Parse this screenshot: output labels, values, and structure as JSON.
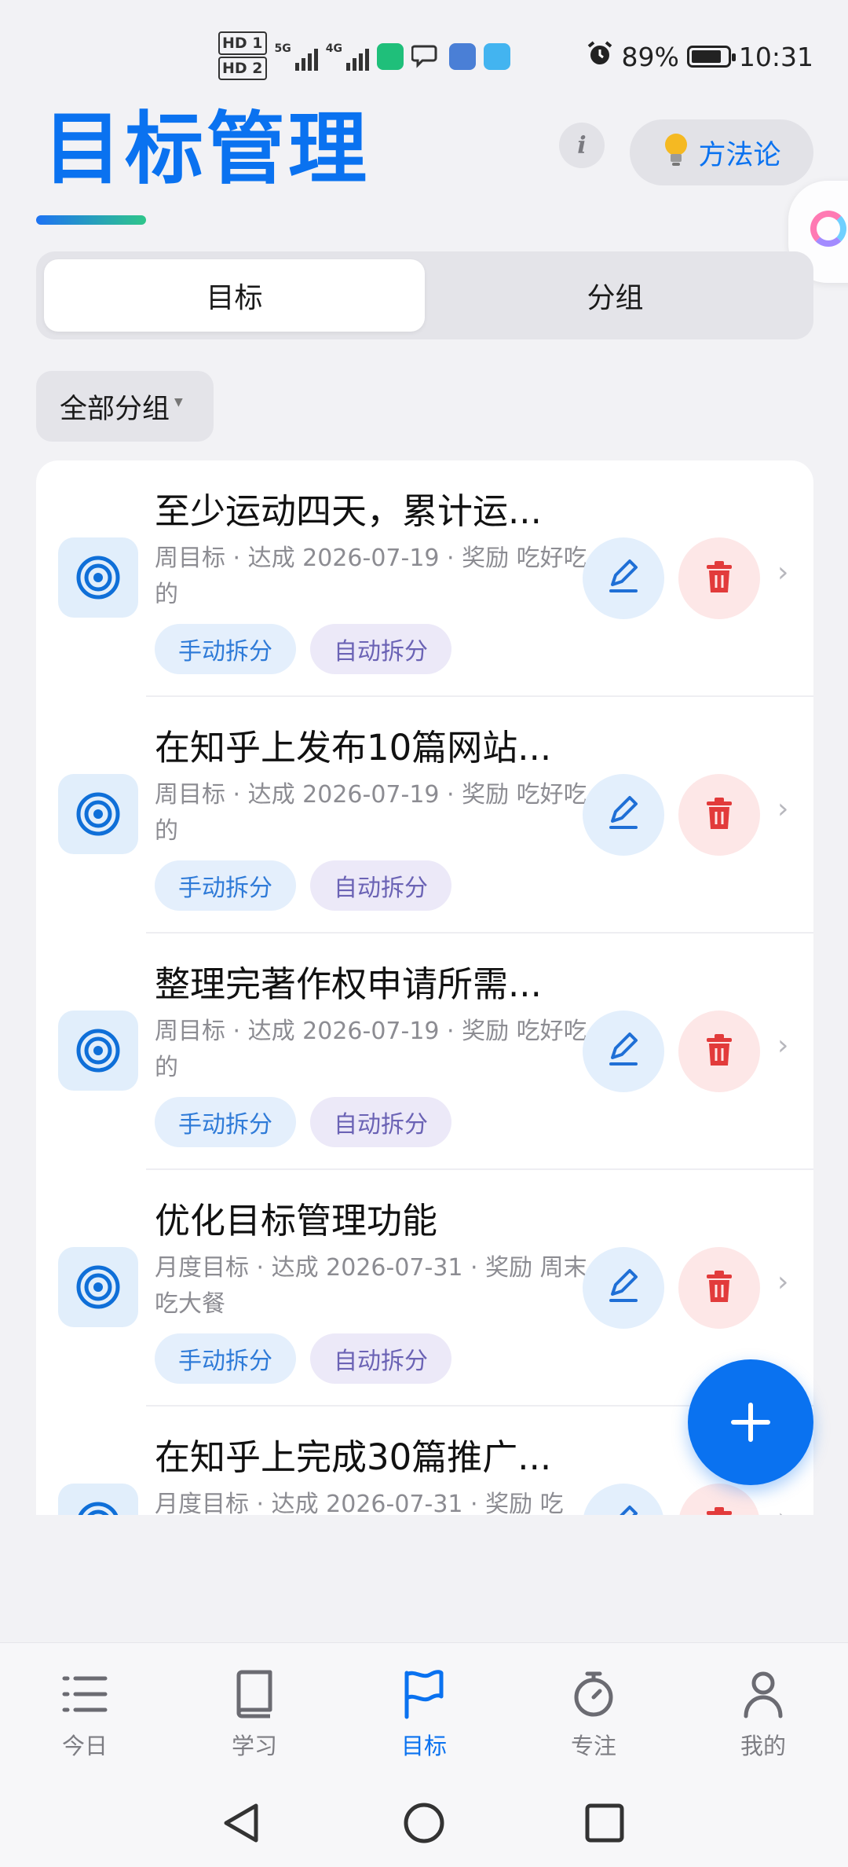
{
  "status_bar": {
    "hd1": "HD 1",
    "hd2": "HD 2",
    "net1": "5G",
    "net2": "4G",
    "battery": "89%",
    "time": "10:31"
  },
  "header": {
    "title": "目标管理",
    "info_label": "i",
    "method_label": "方法论"
  },
  "tabs": [
    {
      "label": "目标",
      "active": true
    },
    {
      "label": "分组",
      "active": false
    }
  ],
  "filter": {
    "label": "全部分组"
  },
  "goals": [
    {
      "title": "至少运动四天，累计运...",
      "meta": "周目标 · 达成 2026-07-19 · 奖励 吃好吃的",
      "tags": [
        "手动拆分",
        "自动拆分"
      ]
    },
    {
      "title": "在知乎上发布10篇网站...",
      "meta": "周目标 · 达成 2026-07-19 · 奖励 吃好吃的",
      "tags": [
        "手动拆分",
        "自动拆分"
      ]
    },
    {
      "title": "整理完著作权申请所需...",
      "meta": "周目标 · 达成 2026-07-19 · 奖励 吃好吃的",
      "tags": [
        "手动拆分",
        "自动拆分"
      ]
    },
    {
      "title": "优化目标管理功能",
      "meta": "月度目标 · 达成 2026-07-31 · 奖励 周末吃大餐",
      "tags": [
        "手动拆分",
        "自动拆分"
      ]
    },
    {
      "title": "在知乎上完成30篇推广...",
      "meta": "月度目标 · 达成 2026-07-31 · 奖励 吃",
      "tags": []
    }
  ],
  "nav": [
    {
      "label": "今日",
      "icon": "list-icon"
    },
    {
      "label": "学习",
      "icon": "book-icon"
    },
    {
      "label": "目标",
      "icon": "flag-icon",
      "active": true
    },
    {
      "label": "专注",
      "icon": "timer-icon"
    },
    {
      "label": "我的",
      "icon": "person-icon"
    }
  ],
  "colors": {
    "accent": "#0a72f0",
    "danger": "#e23b3b",
    "bg": "#f2f2f5"
  }
}
